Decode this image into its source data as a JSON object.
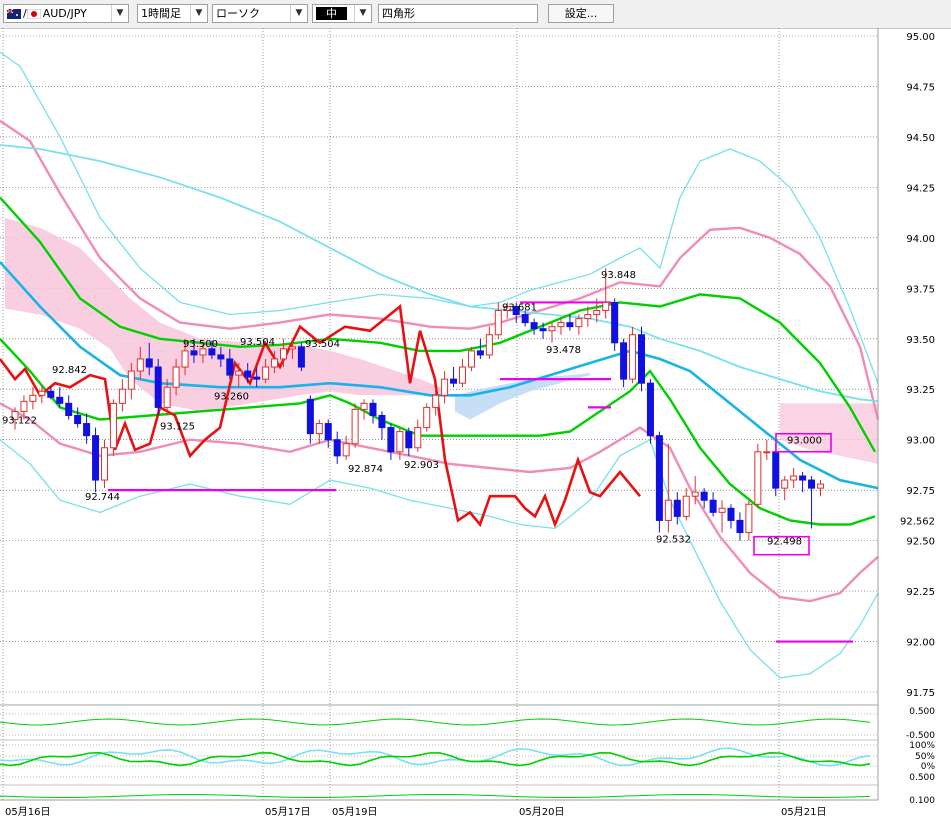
{
  "toolbar": {
    "pair": "AUD/JPY",
    "timeframe": "1時間足",
    "chart_style": "ローソク",
    "size": "中",
    "drawing_tool": "四角形",
    "settings_label": "設定..."
  },
  "colors": {
    "bull_candle": "#e03030",
    "bear_candle": "#1010e0",
    "ichimoku_cloud": "#f8c6dc",
    "bb_outer": "#78e0f0",
    "bb_inner": "#f08cb8",
    "ma_fast": "#00d000",
    "ma_slow": "#18b4e8",
    "rci": "#e81010",
    "horizontal_lines": "#ee00ee"
  },
  "chart_data": {
    "type": "candlestick",
    "y_axis_ticks": [
      "95.00",
      "94.75",
      "94.50",
      "94.25",
      "94.00",
      "93.75",
      "93.50",
      "93.25",
      "93.00",
      "92.75",
      "92.50",
      "92.25",
      "92.00",
      "91.75"
    ],
    "ylim": [
      91.75,
      95.0
    ],
    "x_axis_labels": [
      "05月16日",
      "05月17日",
      "05月19日",
      "05月20日",
      "05月21日"
    ],
    "current_price_label": "92.562",
    "price_annotations": [
      "93.122",
      "92.842",
      "92.744",
      "93.500",
      "93.125",
      "93.504",
      "93.260",
      "93.504",
      "92.874",
      "92.903",
      "93.681",
      "93.478",
      "93.848",
      "92.532",
      "93.000",
      "92.498"
    ],
    "boxed_annotations": [
      "93.000",
      "92.498"
    ],
    "horizontal_levels": [
      92.75,
      93.3,
      93.68,
      93.16,
      92.0
    ],
    "lower_panel_ticks": [
      "0.500",
      "-0.500",
      "100%",
      "50%",
      "0%",
      "0.500",
      "0.100"
    ],
    "candles": [
      {
        "o": 93.1,
        "h": 93.16,
        "l": 93.05,
        "c": 93.14
      },
      {
        "o": 93.14,
        "h": 93.22,
        "l": 93.1,
        "c": 93.19
      },
      {
        "o": 93.19,
        "h": 93.26,
        "l": 93.15,
        "c": 93.22
      },
      {
        "o": 93.22,
        "h": 93.27,
        "l": 93.18,
        "c": 93.24
      },
      {
        "o": 93.24,
        "h": 93.26,
        "l": 93.2,
        "c": 93.21
      },
      {
        "o": 93.21,
        "h": 93.26,
        "l": 93.16,
        "c": 93.18
      },
      {
        "o": 93.18,
        "h": 93.22,
        "l": 93.1,
        "c": 93.12
      },
      {
        "o": 93.12,
        "h": 93.16,
        "l": 93.06,
        "c": 93.08
      },
      {
        "o": 93.08,
        "h": 93.13,
        "l": 92.98,
        "c": 93.02
      },
      {
        "o": 93.02,
        "h": 93.06,
        "l": 92.74,
        "c": 92.8
      },
      {
        "o": 92.8,
        "h": 93.0,
        "l": 92.76,
        "c": 92.96
      },
      {
        "o": 92.96,
        "h": 93.2,
        "l": 92.92,
        "c": 93.18
      },
      {
        "o": 93.18,
        "h": 93.3,
        "l": 93.14,
        "c": 93.25
      },
      {
        "o": 93.25,
        "h": 93.38,
        "l": 93.2,
        "c": 93.34
      },
      {
        "o": 93.34,
        "h": 93.46,
        "l": 93.3,
        "c": 93.4
      },
      {
        "o": 93.4,
        "h": 93.48,
        "l": 93.32,
        "c": 93.36
      },
      {
        "o": 93.36,
        "h": 93.4,
        "l": 93.12,
        "c": 93.16
      },
      {
        "o": 93.16,
        "h": 93.3,
        "l": 93.12,
        "c": 93.26
      },
      {
        "o": 93.26,
        "h": 93.4,
        "l": 93.22,
        "c": 93.36
      },
      {
        "o": 93.36,
        "h": 93.5,
        "l": 93.32,
        "c": 93.44
      },
      {
        "o": 93.44,
        "h": 93.5,
        "l": 93.38,
        "c": 93.42
      },
      {
        "o": 93.42,
        "h": 93.48,
        "l": 93.38,
        "c": 93.45
      },
      {
        "o": 93.45,
        "h": 93.49,
        "l": 93.4,
        "c": 93.42
      },
      {
        "o": 93.42,
        "h": 93.46,
        "l": 93.36,
        "c": 93.4
      },
      {
        "o": 93.4,
        "h": 93.45,
        "l": 93.3,
        "c": 93.32
      },
      {
        "o": 93.32,
        "h": 93.38,
        "l": 93.26,
        "c": 93.34
      },
      {
        "o": 93.34,
        "h": 93.38,
        "l": 93.28,
        "c": 93.31
      },
      {
        "o": 93.31,
        "h": 93.36,
        "l": 93.26,
        "c": 93.3
      },
      {
        "o": 93.3,
        "h": 93.4,
        "l": 93.28,
        "c": 93.36
      },
      {
        "o": 93.36,
        "h": 93.44,
        "l": 93.33,
        "c": 93.4
      },
      {
        "o": 93.4,
        "h": 93.5,
        "l": 93.36,
        "c": 93.45
      },
      {
        "o": 93.45,
        "h": 93.5,
        "l": 93.4,
        "c": 93.46
      },
      {
        "o": 93.46,
        "h": 93.48,
        "l": 93.34,
        "c": 93.36
      },
      {
        "o": 93.2,
        "h": 93.22,
        "l": 92.98,
        "c": 93.03
      },
      {
        "o": 93.03,
        "h": 93.1,
        "l": 92.98,
        "c": 93.08
      },
      {
        "o": 93.08,
        "h": 93.1,
        "l": 92.96,
        "c": 93.0
      },
      {
        "o": 93.0,
        "h": 93.04,
        "l": 92.88,
        "c": 92.92
      },
      {
        "o": 92.92,
        "h": 93.02,
        "l": 92.9,
        "c": 92.98
      },
      {
        "o": 92.98,
        "h": 93.18,
        "l": 92.96,
        "c": 93.15
      },
      {
        "o": 93.15,
        "h": 93.2,
        "l": 93.1,
        "c": 93.18
      },
      {
        "o": 93.18,
        "h": 93.2,
        "l": 93.08,
        "c": 93.12
      },
      {
        "o": 93.12,
        "h": 93.14,
        "l": 93.0,
        "c": 93.06
      },
      {
        "o": 93.06,
        "h": 93.08,
        "l": 92.9,
        "c": 92.94
      },
      {
        "o": 92.94,
        "h": 93.06,
        "l": 92.9,
        "c": 93.04
      },
      {
        "o": 93.04,
        "h": 93.06,
        "l": 92.92,
        "c": 92.96
      },
      {
        "o": 92.96,
        "h": 93.1,
        "l": 92.94,
        "c": 93.06
      },
      {
        "o": 93.06,
        "h": 93.18,
        "l": 93.04,
        "c": 93.16
      },
      {
        "o": 93.16,
        "h": 93.26,
        "l": 93.12,
        "c": 93.22
      },
      {
        "o": 93.22,
        "h": 93.34,
        "l": 93.18,
        "c": 93.3
      },
      {
        "o": 93.3,
        "h": 93.36,
        "l": 93.26,
        "c": 93.28
      },
      {
        "o": 93.28,
        "h": 93.4,
        "l": 93.26,
        "c": 93.36
      },
      {
        "o": 93.36,
        "h": 93.46,
        "l": 93.34,
        "c": 93.44
      },
      {
        "o": 93.44,
        "h": 93.5,
        "l": 93.4,
        "c": 93.42
      },
      {
        "o": 93.42,
        "h": 93.56,
        "l": 93.4,
        "c": 93.52
      },
      {
        "o": 93.52,
        "h": 93.68,
        "l": 93.5,
        "c": 93.64
      },
      {
        "o": 93.64,
        "h": 93.68,
        "l": 93.6,
        "c": 93.66
      },
      {
        "o": 93.66,
        "h": 93.68,
        "l": 93.58,
        "c": 93.62
      },
      {
        "o": 93.62,
        "h": 93.64,
        "l": 93.56,
        "c": 93.58
      },
      {
        "o": 93.58,
        "h": 93.6,
        "l": 93.52,
        "c": 93.55
      },
      {
        "o": 93.55,
        "h": 93.58,
        "l": 93.5,
        "c": 93.54
      },
      {
        "o": 93.54,
        "h": 93.58,
        "l": 93.48,
        "c": 93.56
      },
      {
        "o": 93.56,
        "h": 93.6,
        "l": 93.52,
        "c": 93.58
      },
      {
        "o": 93.58,
        "h": 93.62,
        "l": 93.54,
        "c": 93.56
      },
      {
        "o": 93.56,
        "h": 93.62,
        "l": 93.52,
        "c": 93.6
      },
      {
        "o": 93.6,
        "h": 93.66,
        "l": 93.56,
        "c": 93.62
      },
      {
        "o": 93.62,
        "h": 93.7,
        "l": 93.58,
        "c": 93.64
      },
      {
        "o": 93.64,
        "h": 93.85,
        "l": 93.6,
        "c": 93.68
      },
      {
        "o": 93.68,
        "h": 93.7,
        "l": 93.44,
        "c": 93.48
      },
      {
        "o": 93.48,
        "h": 93.5,
        "l": 93.26,
        "c": 93.3
      },
      {
        "o": 93.3,
        "h": 93.56,
        "l": 93.28,
        "c": 93.52
      },
      {
        "o": 93.52,
        "h": 93.56,
        "l": 93.24,
        "c": 93.28
      },
      {
        "o": 93.28,
        "h": 93.3,
        "l": 92.98,
        "c": 93.02
      },
      {
        "o": 93.02,
        "h": 93.04,
        "l": 92.54,
        "c": 92.6
      },
      {
        "o": 92.6,
        "h": 92.98,
        "l": 92.54,
        "c": 92.7
      },
      {
        "o": 92.7,
        "h": 92.74,
        "l": 92.58,
        "c": 92.62
      },
      {
        "o": 92.62,
        "h": 92.76,
        "l": 92.6,
        "c": 92.72
      },
      {
        "o": 92.72,
        "h": 92.82,
        "l": 92.68,
        "c": 92.74
      },
      {
        "o": 92.74,
        "h": 92.76,
        "l": 92.66,
        "c": 92.7
      },
      {
        "o": 92.7,
        "h": 92.74,
        "l": 92.62,
        "c": 92.64
      },
      {
        "o": 92.64,
        "h": 92.7,
        "l": 92.54,
        "c": 92.66
      },
      {
        "o": 92.66,
        "h": 92.68,
        "l": 92.56,
        "c": 92.6
      },
      {
        "o": 92.6,
        "h": 92.64,
        "l": 92.5,
        "c": 92.54
      },
      {
        "o": 92.54,
        "h": 92.7,
        "l": 92.5,
        "c": 92.68
      },
      {
        "o": 92.68,
        "h": 92.98,
        "l": 92.66,
        "c": 92.94
      },
      {
        "o": 92.94,
        "h": 93.0,
        "l": 92.9,
        "c": 92.94
      },
      {
        "o": 92.94,
        "h": 92.98,
        "l": 92.72,
        "c": 92.76
      },
      {
        "o": 92.76,
        "h": 92.82,
        "l": 92.7,
        "c": 92.8
      },
      {
        "o": 92.8,
        "h": 92.86,
        "l": 92.76,
        "c": 92.82
      },
      {
        "o": 92.82,
        "h": 92.84,
        "l": 92.74,
        "c": 92.8
      },
      {
        "o": 92.8,
        "h": 92.82,
        "l": 92.56,
        "c": 92.76
      },
      {
        "o": 92.76,
        "h": 92.8,
        "l": 92.72,
        "c": 92.78
      }
    ]
  }
}
